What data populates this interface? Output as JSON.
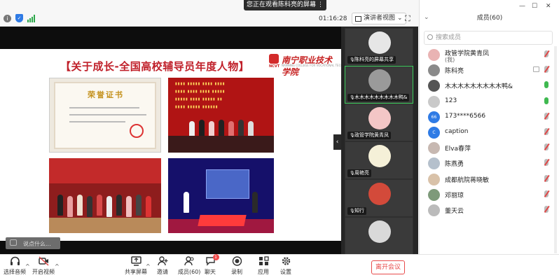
{
  "banner": {
    "text": "您正在观看陈科亮的屏幕",
    "control": "⋮⋮"
  },
  "topbar": {
    "timer": "01:16:28",
    "view_label": "演讲者视图",
    "view_chevron": "⌄",
    "fullscreen_icon": "⛶"
  },
  "slide": {
    "title": "【关于成长-全国高校辅导员年度人物】",
    "logo_text": "南宁职业技术学院",
    "logo_sub": "NCVT",
    "logo_en": "NANNING COLLEGE FOR VOCATIONAL TECHNOLOGY",
    "cert_title": "荣誉证书"
  },
  "chat": {
    "placeholder": "说点什么..."
  },
  "collapse_arrow": "‹",
  "video_tiles": [
    {
      "caption": "陈科亮的屏幕共享",
      "avatar_color": "#e6e6e6"
    },
    {
      "caption": "木木木木木木木木木鸭&",
      "avatar_color": "#9a9a9a"
    },
    {
      "caption": "政管学院黄青凤",
      "avatar_color": "#f3c6c6"
    },
    {
      "caption": "周艳亮",
      "avatar_color": "#f5f0d8"
    },
    {
      "caption": "知行",
      "avatar_color": "#d34a3a"
    },
    {
      "caption": "",
      "avatar_color": "#d9d9d9"
    }
  ],
  "members": {
    "title": "成员(60)",
    "collapse": "⌄",
    "search_placeholder": "搜索成员",
    "list": [
      {
        "name": "政管学院黄青凤",
        "sub": "(我)",
        "avatar_text": "",
        "avatar_color": "#e9b3b3",
        "mic": "off",
        "cam": false
      },
      {
        "name": "陈科亮",
        "sub": "",
        "avatar_text": "",
        "avatar_color": "#8a8a8a",
        "mic": "off",
        "cam": true
      },
      {
        "name": "木木木木木木木木木鸭&",
        "sub": "",
        "avatar_text": "",
        "avatar_color": "#555555",
        "mic": "on",
        "cam": false
      },
      {
        "name": "123",
        "sub": "",
        "avatar_text": "",
        "avatar_color": "#c9c9c9",
        "mic": "on",
        "cam": false
      },
      {
        "name": "173****6566",
        "sub": "",
        "avatar_text": "66",
        "avatar_color": "#2f7be5",
        "mic": "off",
        "cam": false
      },
      {
        "name": "caption",
        "sub": "",
        "avatar_text": "C",
        "avatar_color": "#2f7be5",
        "mic": "off",
        "cam": false
      },
      {
        "name": "Elva春萍",
        "sub": "",
        "avatar_text": "",
        "avatar_color": "#c7b8b1",
        "mic": "off",
        "cam": false
      },
      {
        "name": "陈燕勇",
        "sub": "",
        "avatar_text": "",
        "avatar_color": "#b5c0cc",
        "mic": "off",
        "cam": false
      },
      {
        "name": "成都航院蒋晓敏",
        "sub": "",
        "avatar_text": "",
        "avatar_color": "#d9c2a9",
        "mic": "off",
        "cam": false
      },
      {
        "name": "邓丽琼",
        "sub": "",
        "avatar_text": "",
        "avatar_color": "#7e9a7a",
        "mic": "off",
        "cam": false
      },
      {
        "name": "董天云",
        "sub": "",
        "avatar_text": "",
        "avatar_color": "#bbb",
        "mic": "off",
        "cam": false
      }
    ]
  },
  "toolbar": {
    "audio_label": "选择音频",
    "video_label": "开启视频",
    "share_label": "共享屏幕",
    "invite_label": "邀请",
    "members_label": "成员(60)",
    "chat_label": "聊天",
    "chat_badge": "1",
    "record_label": "录制",
    "apps_label": "应用",
    "settings_label": "设置",
    "leave_label": "离开会议",
    "caret": "^"
  },
  "window": {
    "minimize": "—",
    "maximize": "☐",
    "close": "✕"
  }
}
